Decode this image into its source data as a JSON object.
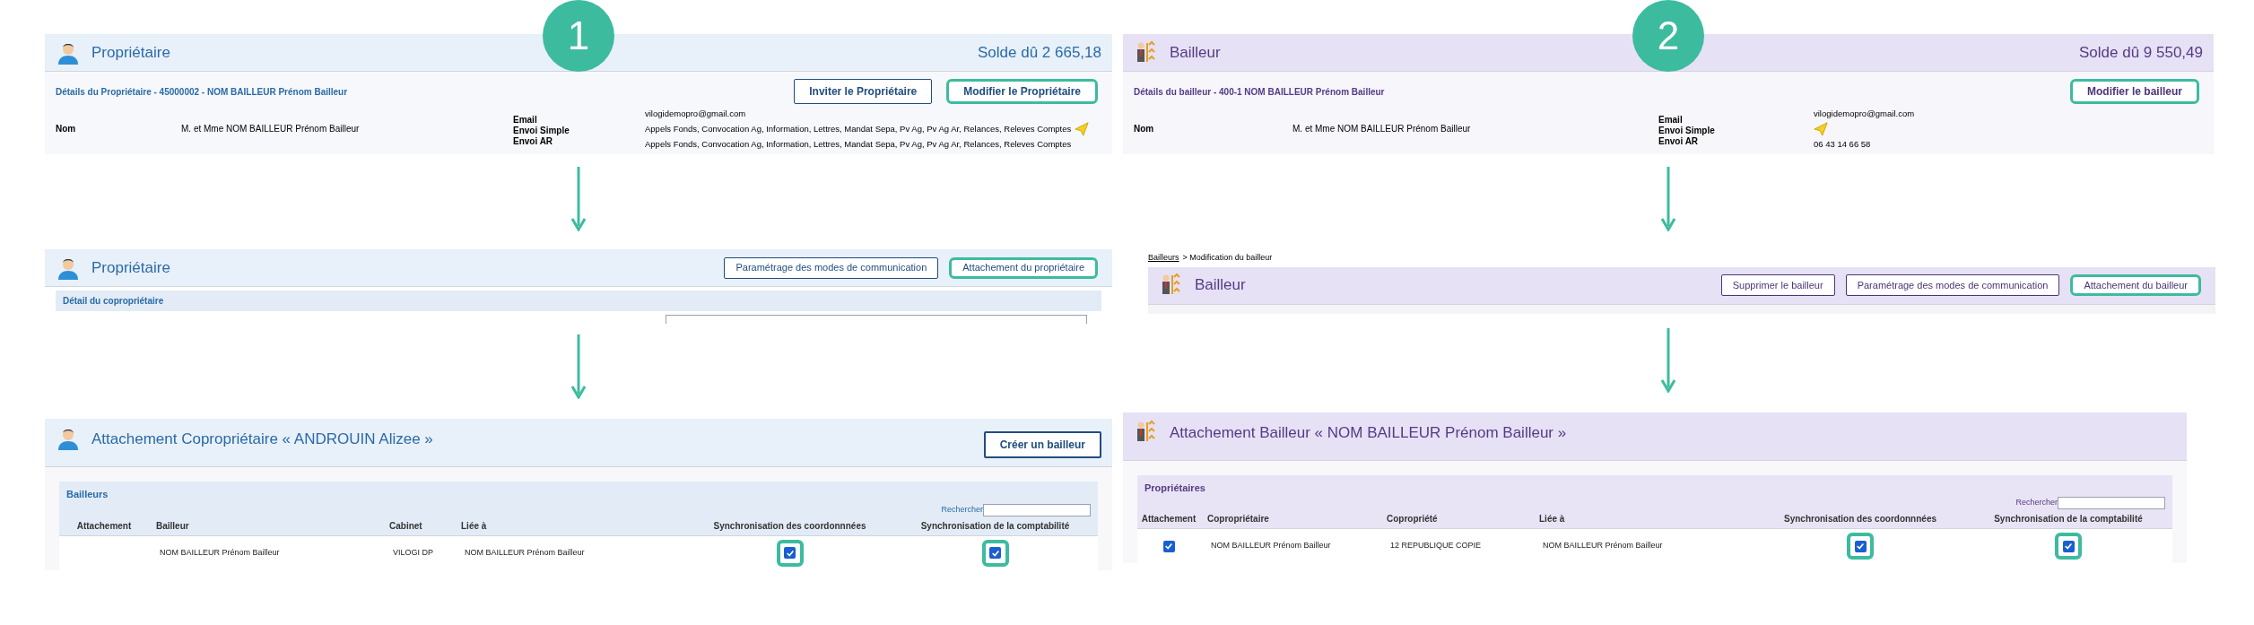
{
  "columns": [
    {
      "badge": "1",
      "detail_card": {
        "title": "Propriétaire",
        "balance": "Solde dû 2 665,18",
        "subtitle": "Détails du Propriétaire - 45000002 - NOM BAILLEUR Prénom Bailleur",
        "buttons": [
          {
            "label": "Inviter le Propriétaire",
            "highlighted": false
          },
          {
            "label": "Modifier le Propriétaire",
            "highlighted": true
          }
        ],
        "name_label": "Nom",
        "name_value": "M. et Mme NOM BAILLEUR Prénom Bailleur",
        "contact_labels": [
          "Email",
          "Envoi Simple",
          "Envoi AR"
        ],
        "contact_lines": [
          {
            "kind": "text",
            "text": "vilogidemopro@gmail.com",
            "send_icon": false
          },
          {
            "kind": "text",
            "text": "Appels Fonds, Convocation Ag, Information, Lettres, Mandat Sepa, Pv Ag, Pv Ag Ar, Relances, Releves Comptes",
            "send_icon": true
          },
          {
            "kind": "text",
            "text": "Appels Fonds, Convocation Ag, Information, Lettres, Mandat Sepa, Pv Ag, Pv Ag Ar, Relances, Releves Comptes",
            "send_icon": false
          }
        ]
      },
      "edit_page": {
        "title": "Propriétaire",
        "buttons": [
          {
            "label": "Paramétrage des modes de communication",
            "highlighted": false
          },
          {
            "label": "Attachement du propriétaire",
            "highlighted": true
          }
        ],
        "section": "Détail du copropriétaire"
      },
      "attachment_page": {
        "title": "Attachement Copropriétaire « ANDROUIN Alizee »",
        "button": "Créer un bailleur",
        "section": "Bailleurs",
        "search_label": "Rechercher",
        "columns": [
          "Attachement",
          "Bailleur",
          "Cabinet",
          "Liée à",
          "Synchronisation des coordonnnées",
          "Synchronisation de la comptabilité"
        ],
        "rows": [
          {
            "cells": [
              "",
              "NOM BAILLEUR Prénom Bailleur",
              "VILOGI DP",
              "NOM BAILLEUR Prénom Bailleur",
              {
                "checked": true,
                "highlighted": true
              },
              {
                "checked": true,
                "highlighted": true
              }
            ]
          }
        ]
      }
    },
    {
      "badge": "2",
      "detail_card": {
        "title": "Bailleur",
        "balance": "Solde dû 9 550,49",
        "subtitle": "Détails du bailleur - 400-1 NOM BAILLEUR Prénom Bailleur",
        "buttons": [
          {
            "label": "Modifier le bailleur",
            "highlighted": true
          }
        ],
        "name_label": "Nom",
        "name_value": "M. et Mme NOM BAILLEUR Prénom Bailleur",
        "contact_labels": [
          "Email",
          "Envoi Simple",
          "Envoi AR"
        ],
        "contact_lines": [
          {
            "kind": "text",
            "text": "vilogidemopro@gmail.com",
            "send_icon": false
          },
          {
            "kind": "icon"
          },
          {
            "kind": "text",
            "text": "06 43 14 66 58",
            "send_icon": false
          }
        ]
      },
      "edit_page": {
        "breadcrumb_link": "Bailleurs",
        "breadcrumb_rest": "> Modification du bailleur",
        "title": "Bailleur",
        "buttons": [
          {
            "label": "Supprimer le bailleur",
            "highlighted": false
          },
          {
            "label": "Paramétrage des modes de communication",
            "highlighted": false
          },
          {
            "label": "Attachement du bailleur",
            "highlighted": true
          }
        ]
      },
      "attachment_page": {
        "title": "Attachement Bailleur « NOM BAILLEUR Prénom Bailleur »",
        "section": "Propriétaires",
        "search_label": "Rechercher",
        "columns": [
          "Attachement",
          "Copropriétaire",
          "Copropriété",
          "Liée à",
          "Synchronisation des coordonnnées",
          "Synchronisation de la comptabilité"
        ],
        "rows": [
          {
            "cells": [
              {
                "checked": true,
                "highlighted": false
              },
              "NOM BAILLEUR Prénom Bailleur",
              "12 REPUBLIQUE COPIE",
              "NOM BAILLEUR Prénom Bailleur",
              {
                "checked": true,
                "highlighted": true
              },
              {
                "checked": true,
                "highlighted": true
              }
            ]
          }
        ]
      }
    }
  ]
}
